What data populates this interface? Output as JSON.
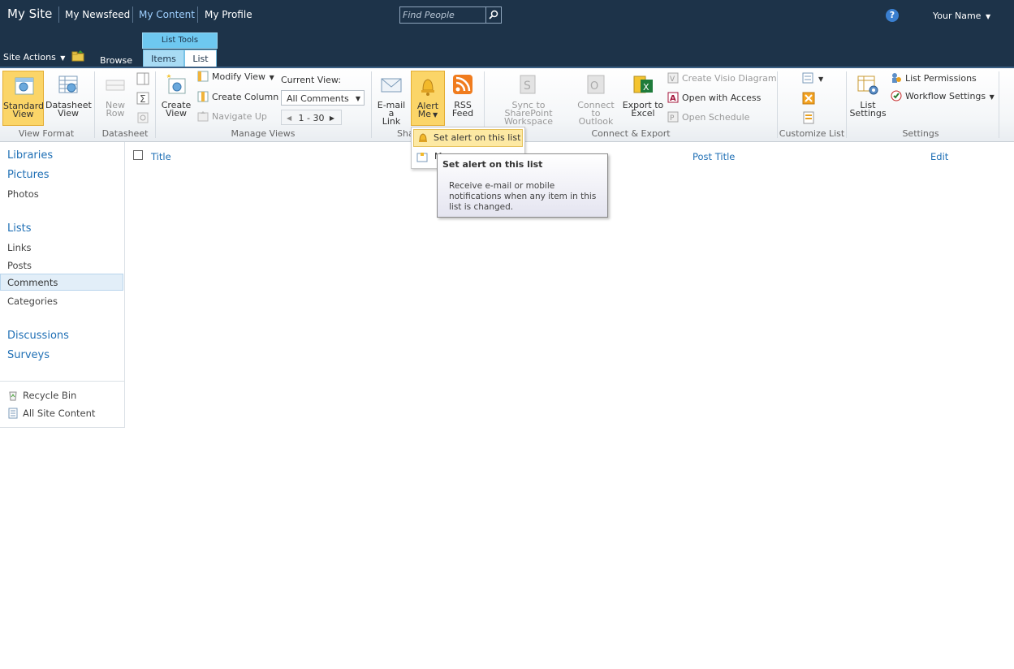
{
  "topbar": {
    "site_title": "My Site",
    "nav": [
      "My Newsfeed",
      "My Content",
      "My Profile"
    ],
    "active_nav": "My Content",
    "search_placeholder": "Find People",
    "help": "?",
    "user_name": "Your Name"
  },
  "ribbon_tabs": {
    "site_actions": "Site Actions",
    "browse": "Browse",
    "context_group": "List Tools",
    "items": "Items",
    "list": "List"
  },
  "ribbon": {
    "view_format": {
      "label": "View Format",
      "standard_view": [
        "Standard",
        "View"
      ],
      "datasheet_view": [
        "Datasheet",
        "View"
      ]
    },
    "datasheet": {
      "label": "Datasheet",
      "new_row": [
        "New",
        "Row"
      ]
    },
    "manage_views": {
      "label": "Manage Views",
      "create_view": [
        "Create",
        "View"
      ],
      "modify_view": "Modify View",
      "create_column": "Create Column",
      "navigate_up": "Navigate Up",
      "current_view_label": "Current View:",
      "current_view_value": "All Comments",
      "pager": "1 - 30"
    },
    "share_track": {
      "label": "Sha",
      "email_link": [
        "E-mail a",
        "Link"
      ],
      "alert_me": [
        "Alert",
        "Me"
      ],
      "rss_feed": [
        "RSS",
        "Feed"
      ]
    },
    "connect_export": {
      "label": "Connect & Export",
      "sync_sharepoint": [
        "Sync to SharePoint",
        "Workspace"
      ],
      "connect_outlook": [
        "Connect to",
        "Outlook"
      ],
      "export_excel": [
        "Export to",
        "Excel"
      ],
      "create_visio": "Create Visio Diagram",
      "open_access": "Open with Access",
      "open_schedule": "Open Schedule"
    },
    "customize_list": {
      "label": "Customize List"
    },
    "settings": {
      "label": "Settings",
      "list_settings": [
        "List",
        "Settings"
      ],
      "list_permissions": "List Permissions",
      "workflow_settings": "Workflow Settings"
    }
  },
  "alert_menu": {
    "item1": "Set alert on this list",
    "item2": "M"
  },
  "tooltip": {
    "title": "Set alert on this list",
    "body": "Receive e-mail or mobile notifications when any item in this list is changed."
  },
  "quicklaunch": {
    "libraries": "Libraries",
    "pictures": "Pictures",
    "photos": "Photos",
    "lists": "Lists",
    "links": "Links",
    "posts": "Posts",
    "comments": "Comments",
    "categories": "Categories",
    "discussions": "Discussions",
    "surveys": "Surveys",
    "recycle_bin": "Recycle Bin",
    "all_site_content": "All Site Content"
  },
  "list_columns": [
    "Title",
    "Post Title",
    "Edit"
  ],
  "colors": {
    "topbar": "#1d3349",
    "link_blue": "#1f6fb5",
    "selected_gold": "#fbd568",
    "context_tab": "#6ec8f0"
  }
}
